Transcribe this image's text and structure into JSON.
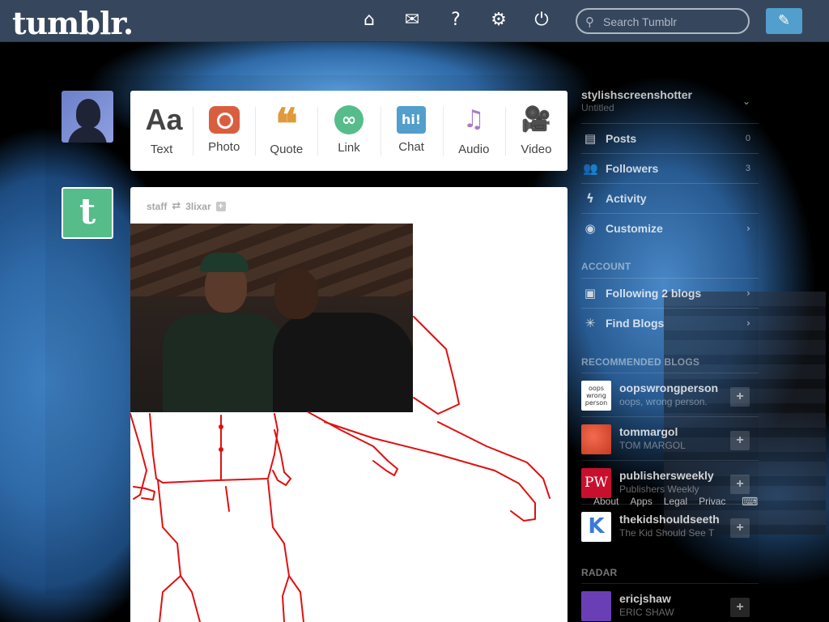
{
  "brand": {
    "logo": "tumblr."
  },
  "nav": {
    "home_icon": "⌂",
    "inbox_icon": "✉",
    "help_icon": "?",
    "settings_icon": "⚙",
    "logout_icon": "⏻",
    "search_icon": "⚲",
    "compose_icon": "✎"
  },
  "search": {
    "placeholder": "Search Tumblr"
  },
  "post_types": [
    {
      "label": "Text",
      "glyph": "Aa"
    },
    {
      "label": "Photo",
      "glyph": ""
    },
    {
      "label": "Quote",
      "glyph": "❝"
    },
    {
      "label": "Link",
      "glyph": "∞"
    },
    {
      "label": "Chat",
      "glyph": "hi!"
    },
    {
      "label": "Audio",
      "glyph": "♫"
    },
    {
      "label": "Video",
      "glyph": "🎥"
    }
  ],
  "post": {
    "author": "staff",
    "reblog_icon": "⇄",
    "reblogged_from": "3lixar",
    "plus": "+"
  },
  "tile": {
    "letter": "t"
  },
  "sidebar": {
    "blog_name": "stylishscreenshotter",
    "blog_subtitle": "Untitled",
    "chevron": "⌄",
    "rows": [
      {
        "label": "Posts",
        "count": "0",
        "icon": "▤"
      },
      {
        "label": "Followers",
        "count": "3",
        "icon": "👥"
      },
      {
        "label": "Activity",
        "icon": "ϟ"
      },
      {
        "label": "Customize",
        "icon": "◉",
        "arrow": "›"
      }
    ],
    "account_heading": "ACCOUNT",
    "account_rows": [
      {
        "label": "Following 2 blogs",
        "icon": "▣",
        "arrow": "›"
      },
      {
        "label": "Find Blogs",
        "icon": "✳",
        "arrow": "›"
      }
    ],
    "recommended_heading": "RECOMMENDED BLOGS",
    "recommended": [
      {
        "name": "oopswrongperson",
        "desc": "oops, wrong person.",
        "avatar_text": "oops wrong person",
        "bg": "#ffffff",
        "fg": "#333333"
      },
      {
        "name": "tommargol",
        "desc": "TOM MARGOL",
        "avatar_text": "",
        "bg": "#d9402b",
        "fg": "#ffffff"
      },
      {
        "name": "publishersweekly",
        "desc": "Publishers Weekly",
        "avatar_text": "PW",
        "bg": "#c8102e",
        "fg": "#ffffff"
      },
      {
        "name": "thekidshouldseeth",
        "desc": "The Kid Should See T",
        "avatar_text": "K",
        "bg": "#ffffff",
        "fg": "#3a7bd5"
      }
    ],
    "follow_plus": "+",
    "footer_links": [
      "About",
      "Apps",
      "Legal",
      "Privac"
    ],
    "keyboard_icon": "⌨",
    "radar_heading": "RADAR",
    "radar": {
      "name": "ericjshaw",
      "desc": "ERIC SHAW"
    }
  },
  "colors": {
    "topbar": "#36465d",
    "accent_blue": "#529ecc",
    "photo_red": "#d95e40",
    "quote_orange": "#e09a3b",
    "link_green": "#56bc8a",
    "audio_purple": "#a77dc2",
    "video_gray": "#748089"
  }
}
